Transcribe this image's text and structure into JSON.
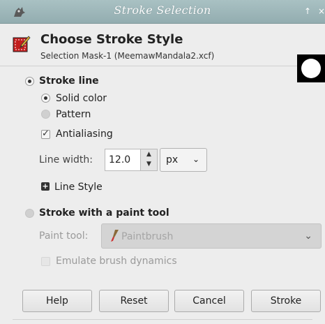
{
  "window": {
    "title": "Stroke Selection"
  },
  "header": {
    "title": "Choose Stroke Style",
    "subtitle": "Selection Mask-1 (MeemawMandala2.xcf)"
  },
  "stroke_line": {
    "label": "Stroke line",
    "selected": true,
    "solid_color": "Solid color",
    "pattern": "Pattern",
    "fill_choice": "Solid color",
    "antialiasing": "Antialiasing",
    "antialiasing_checked": true,
    "line_width_label": "Line width:",
    "line_width_value": "12.0",
    "unit": "px",
    "line_style": "Line Style"
  },
  "paint_tool_section": {
    "label": "Stroke with a paint tool",
    "selected": false,
    "paint_tool_label": "Paint tool:",
    "paint_tool_value": "Paintbrush",
    "emulate": "Emulate brush dynamics",
    "emulate_checked": false
  },
  "buttons": {
    "help": "Help",
    "reset": "Reset",
    "cancel": "Cancel",
    "stroke": "Stroke"
  },
  "icons": {
    "window": "gimp-wilber-icon",
    "header": "stroke-dialog-icon",
    "maximize": "arrow-up-icon",
    "close": "close-icon"
  },
  "colors": {
    "titlebar": "#9fb8bb",
    "background": "#ededed",
    "disabled_text": "#9a9a9a"
  }
}
